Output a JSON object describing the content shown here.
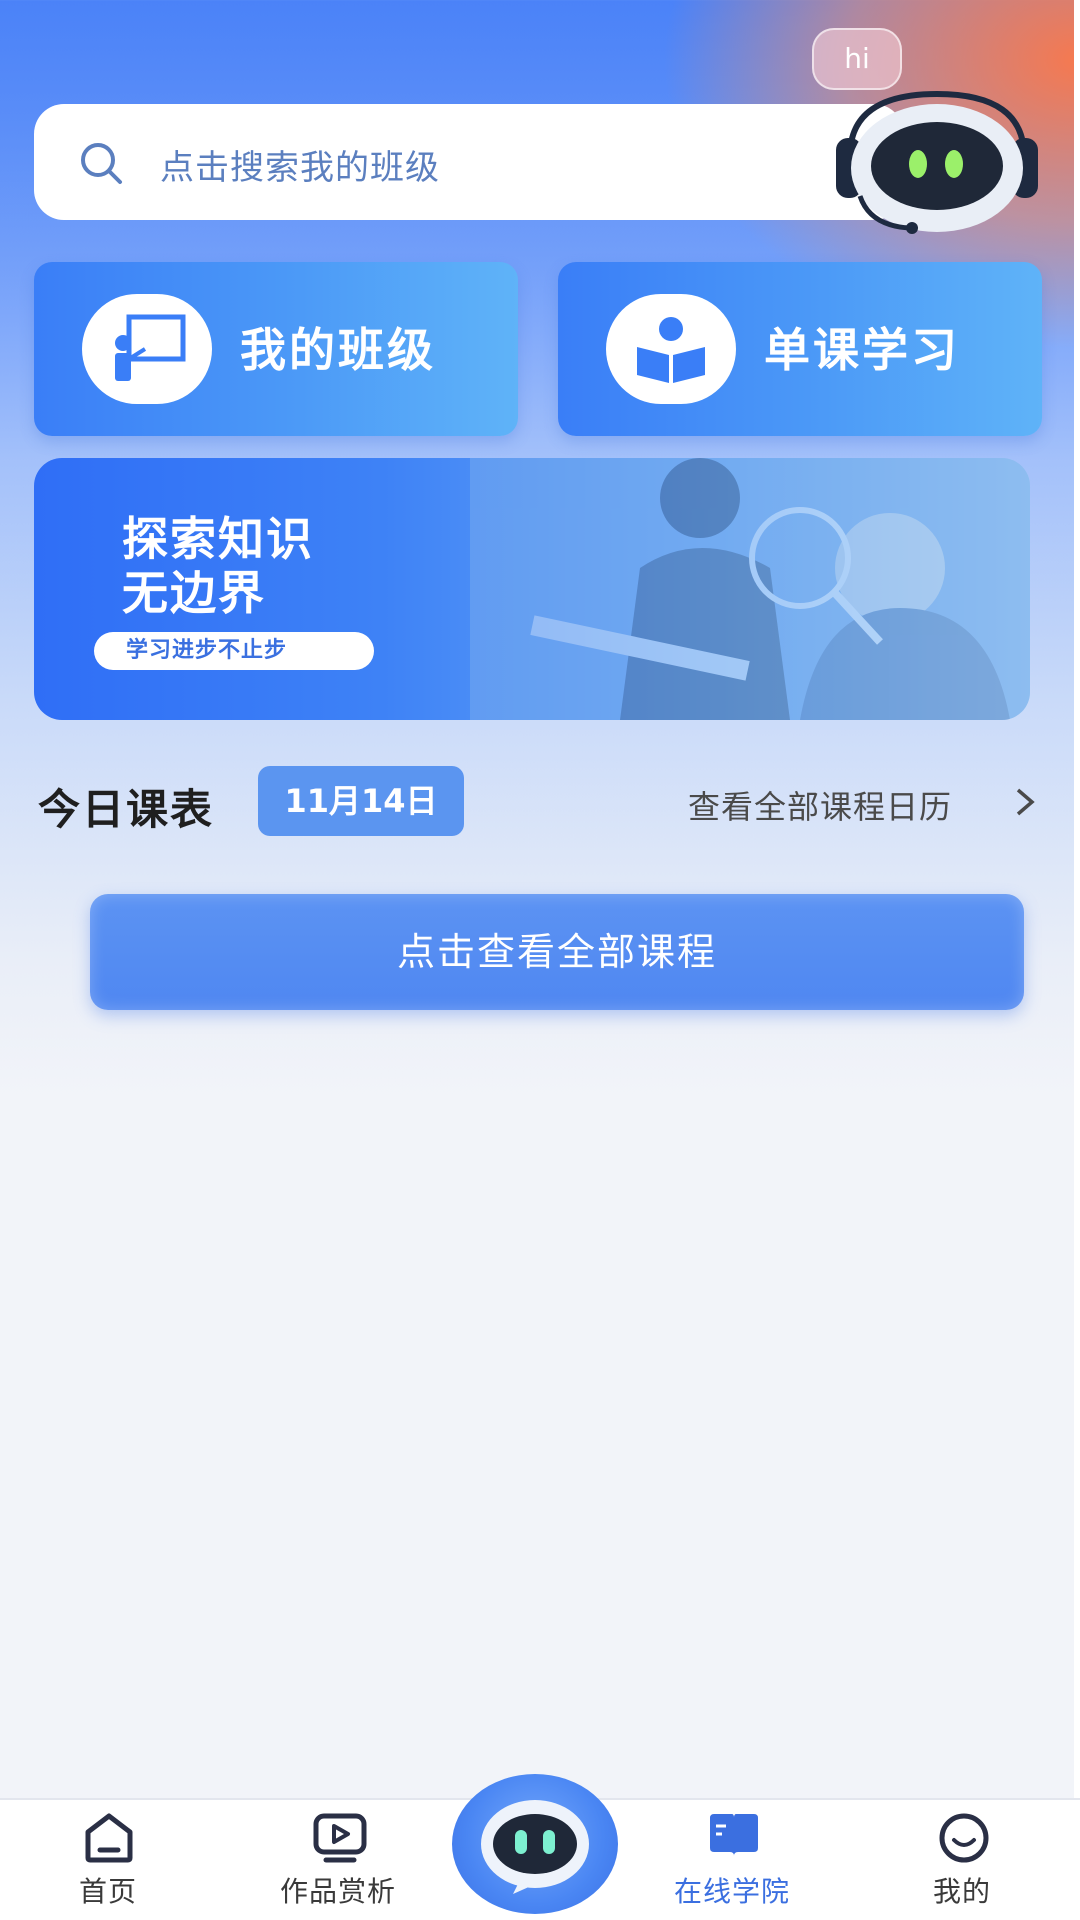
{
  "search": {
    "placeholder": "点击搜索我的班级",
    "icon": "search-icon"
  },
  "assistant": {
    "greeting": "hi",
    "icon": "robot-assistant-icon"
  },
  "cards": [
    {
      "label": "我的班级",
      "icon": "classroom-teacher-icon"
    },
    {
      "label": "单课学习",
      "icon": "book-reader-icon"
    }
  ],
  "banner": {
    "title_line1": "探索知识",
    "title_line2": "无边界",
    "tagline": "学习进步不止步"
  },
  "schedule": {
    "title": "今日课表",
    "date": "11月14日",
    "calendar_link": "查看全部课程日历",
    "view_all_button": "点击查看全部课程"
  },
  "tabbar": {
    "items": [
      {
        "label": "首页",
        "icon": "home-icon",
        "active": false
      },
      {
        "label": "作品赏析",
        "icon": "video-play-icon",
        "active": false
      },
      {
        "label": "",
        "icon": "robot-center-icon",
        "active": false
      },
      {
        "label": "在线学院",
        "icon": "open-book-icon",
        "active": true
      },
      {
        "label": "我的",
        "icon": "smile-profile-icon",
        "active": false
      }
    ]
  },
  "colors": {
    "accent": "#3b6fe0",
    "card_gradient_start": "#3a7ef7",
    "date_badge": "#5b95f0",
    "glow": "#ff7a45"
  }
}
